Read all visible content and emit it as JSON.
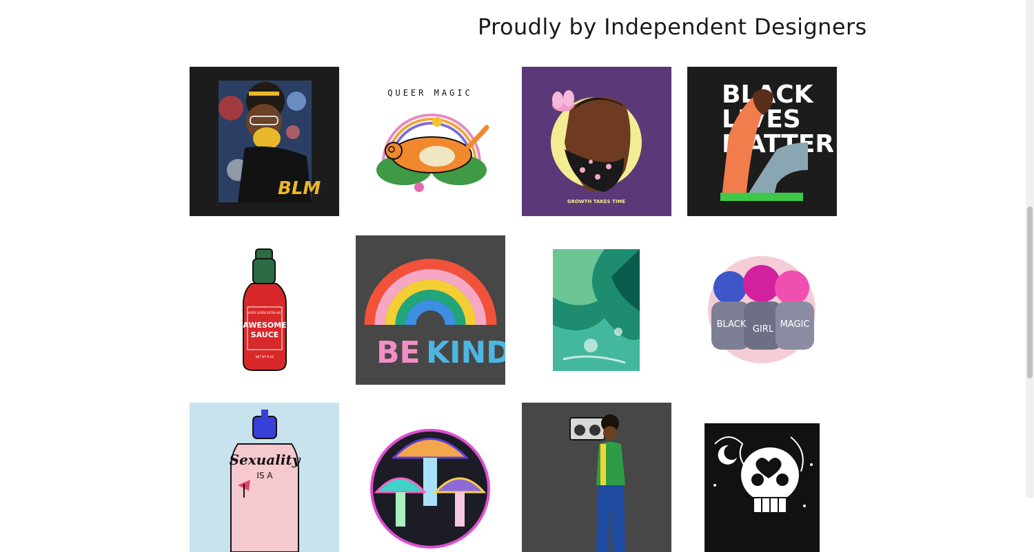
{
  "header": {
    "title": "Proudly by Independent Designers"
  },
  "products": [
    {
      "name": "BLM Mask Portrait",
      "text": "BLM",
      "bg": "#1c1c1c"
    },
    {
      "name": "Queer Magic Cat",
      "text": "QUEER MAGIC",
      "bg": "#ffffff"
    },
    {
      "name": "Growth Takes Time",
      "text": "GROWTH TAKES TIME",
      "bg": "#5b3978"
    },
    {
      "name": "Black Lives Matter Hands",
      "text_line1": "BLACK",
      "text_line2": "LIVES",
      "text_line3": "MATTER",
      "bg": "#1c1c1c"
    },
    {
      "name": "Awesome Sauce Bottle",
      "text_top": "SUPER SUPER EXTRA HOT",
      "text_line1": "AWESOME",
      "text_line2": "SAUCE",
      "text_bottom": "NET WT 8 OZ",
      "bg": "#ffffff"
    },
    {
      "name": "Be Kind Rainbow",
      "text_line1": "BE",
      "text_line2": "KIND",
      "bg": "#474747"
    },
    {
      "name": "Green Abstract",
      "bg": "#ffffff"
    },
    {
      "name": "Black Girl Magic",
      "text_line1": "BLACK",
      "text_line2": "GIRL",
      "text_line3": "MAGIC",
      "bg": "#ffffff"
    },
    {
      "name": "Sexuality Is A Spectrum",
      "text_line1": "Sexuality",
      "text_line2": "IS A",
      "bg": "#c8e2ee"
    },
    {
      "name": "Psychedelic Mushrooms",
      "bg": "#ffffff"
    },
    {
      "name": "Boombox Woman",
      "bg": "#474747"
    },
    {
      "name": "Heartbreak Skull",
      "bg": "#ffffff"
    }
  ]
}
